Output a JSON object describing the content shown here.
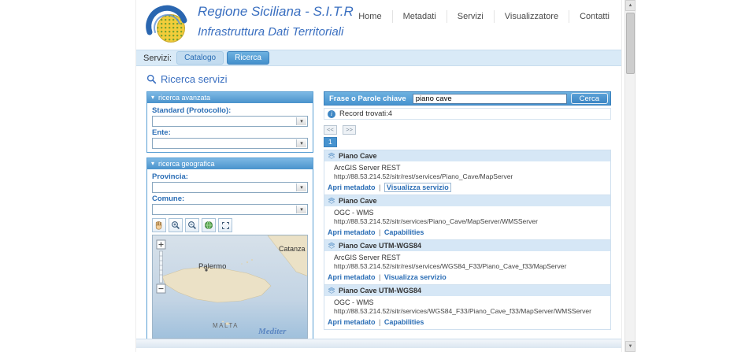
{
  "colors": {
    "brand_blue": "#3a6fc0",
    "accent_blue": "#4793cf",
    "panel_border": "#5a9fd4",
    "tabbar_bg": "#d9eaf7",
    "result_header_bg": "#d6e7f6"
  },
  "header": {
    "brand": {
      "title": "Regione Siciliana - S.I.T.R",
      "subtitle": "Infrastruttura Dati Territoriali"
    },
    "nav": {
      "home": "Home",
      "metadati": "Metadati",
      "servizi": "Servizi",
      "visualizzatore": "Visualizzatore",
      "contatti": "Contatti"
    }
  },
  "tabbar": {
    "label": "Servizi:",
    "catalogo": "Catalogo",
    "ricerca": "Ricerca"
  },
  "page": {
    "title": "Ricerca servizi"
  },
  "panels": {
    "advanced": {
      "title": "ricerca avanzata",
      "standard_label": "Standard (Protocollo):",
      "ente_label": "Ente:"
    },
    "geographic": {
      "title": "ricerca geografica",
      "provincia_label": "Provincia:",
      "comune_label": "Comune:"
    }
  },
  "map": {
    "labels": {
      "palermo": "Palermo",
      "catanzaro": "Catanza",
      "malta": "MALTA",
      "sea": "Mediter"
    }
  },
  "search": {
    "label": "Frase o Parole chiave",
    "value": "piano cave",
    "button": "Cerca",
    "records": "Record trovati:4"
  },
  "pagination": {
    "prev": "<<",
    "next": ">>",
    "current": "1"
  },
  "results": [
    {
      "title": "Piano Cave",
      "type": "ArcGIS Server REST",
      "url": "http://88.53.214.52/sitr/rest/services/Piano_Cave/MapServer",
      "link1": "Apri metadato",
      "link2": "Visualizza servizio"
    },
    {
      "title": "Piano Cave",
      "type": "OGC - WMS",
      "url": "http://88.53.214.52/sitr/services/Piano_Cave/MapServer/WMSServer",
      "link1": "Apri metadato",
      "link2": "Capabilities"
    },
    {
      "title": "Piano Cave UTM-WGS84",
      "type": "ArcGIS Server REST",
      "url": "http://88.53.214.52/sitr/rest/services/WGS84_F33/Piano_Cave_f33/MapServer",
      "link1": "Apri metadato",
      "link2": "Visualizza servizio"
    },
    {
      "title": "Piano Cave UTM-WGS84",
      "type": "OGC - WMS",
      "url": "http://88.53.214.52/sitr/services/WGS84_F33/Piano_Cave_f33/MapServer/WMSServer",
      "link1": "Apri metadato",
      "link2": "Capabilities"
    }
  ],
  "ui": {
    "link_sep": "|"
  },
  "icons": {
    "collapse": "▾",
    "dropdown": "▾",
    "info": "i",
    "scroll_up": "▲",
    "scroll_down": "▼"
  }
}
